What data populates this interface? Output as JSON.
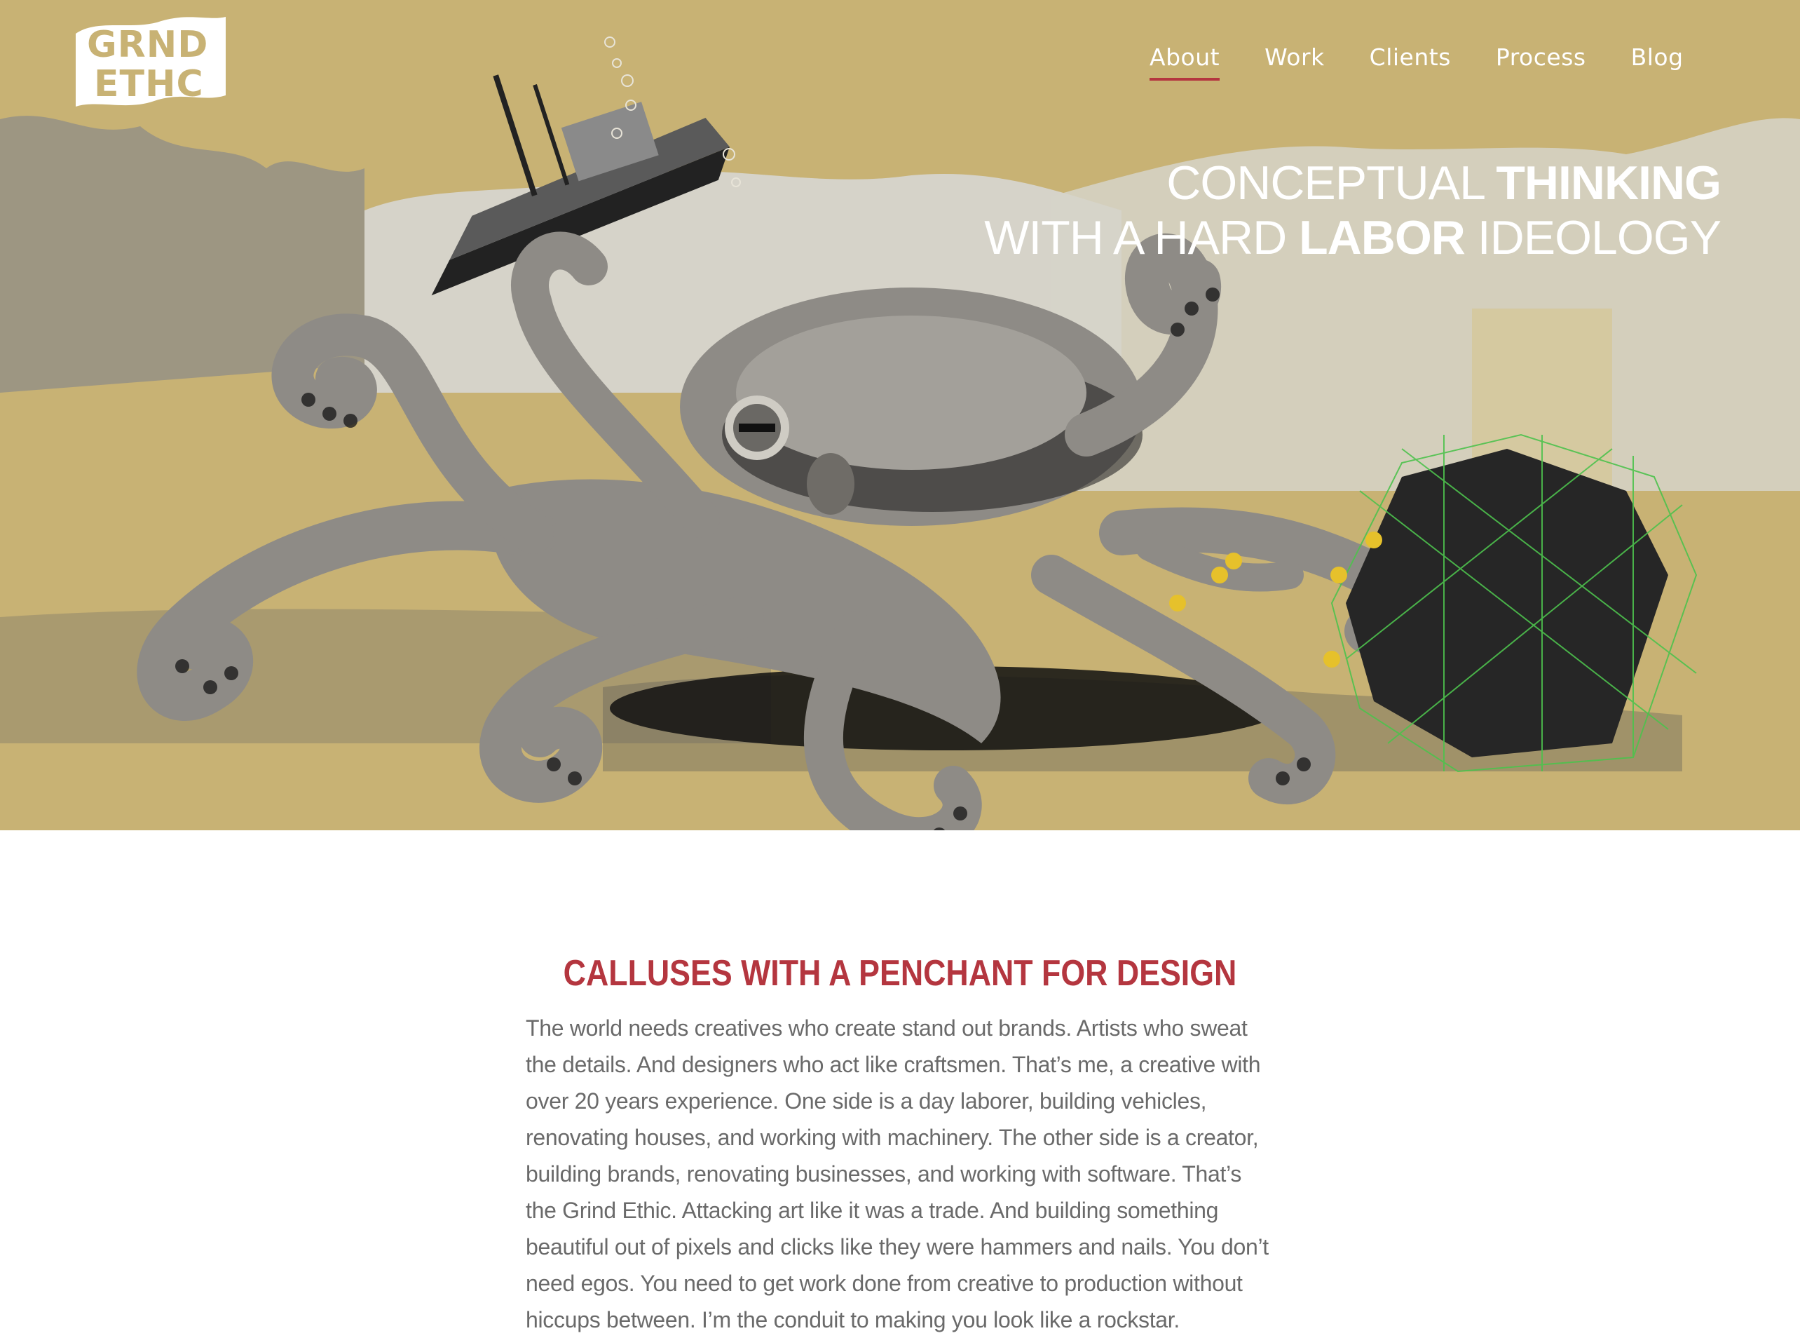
{
  "logo": {
    "line1": "GRND",
    "line2": "ETHC"
  },
  "nav": [
    {
      "label": "About",
      "active": true
    },
    {
      "label": "Work",
      "active": false
    },
    {
      "label": "Clients",
      "active": false
    },
    {
      "label": "Process",
      "active": false
    },
    {
      "label": "Blog",
      "active": false
    }
  ],
  "hero": {
    "line1_light": "CONCEPTUAL ",
    "line1_bold": "THINKING",
    "line2_light_a": "WITH A HARD ",
    "line2_bold": "LABOR",
    "line2_light_b": " IDEOLOGY"
  },
  "intro": {
    "heading": "CALLUSES WITH A PENCHANT FOR DESIGN",
    "body": "The world needs creatives who create stand out brands. Artists who sweat the details. And designers who act like craftsmen. That’s me, a creative with over 20 years experience. One side is a day laborer, building vehicles, renovating houses, and working with machinery. The other side is a creator, building brands, renovating businesses, and working with software. That’s the Grind Ethic. Attacking art like it was a trade. And building something beautiful out of pixels and clicks like they were hammers and nails. You don’t need egos. You need to get work done from creative to production without hiccups between. I’m the conduit to making you look like a rockstar."
  },
  "colors": {
    "hero_bg": "#c8b274",
    "accent": "#b4363f",
    "body_text": "#6a6a6a",
    "octopus": "#8e8b86"
  }
}
